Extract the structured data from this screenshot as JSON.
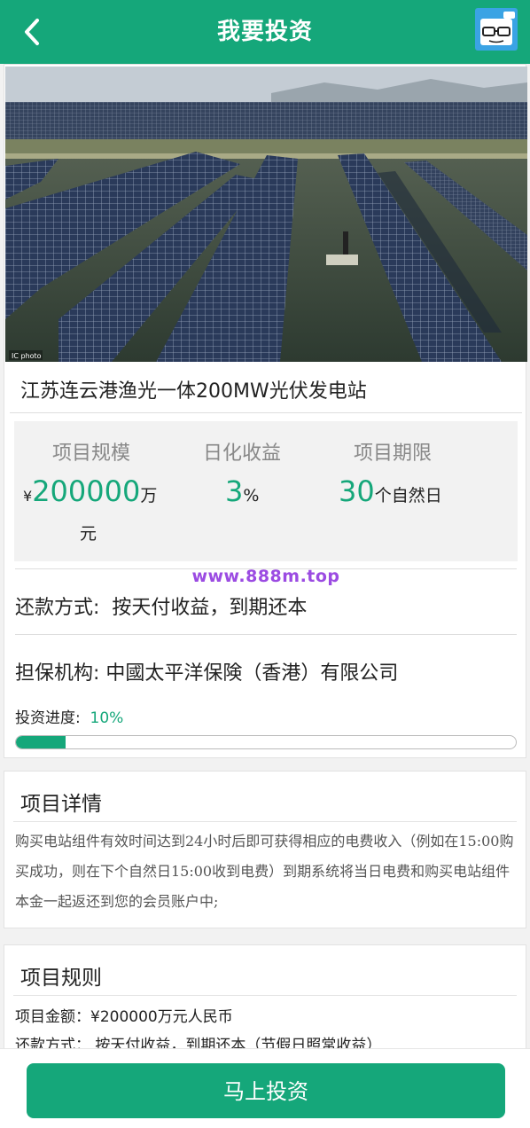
{
  "header": {
    "title": "我要投资",
    "back_icon": "chevron-left-icon",
    "avatar_icon": "cartoon-avatar-icon"
  },
  "project": {
    "name": "江苏连云港渔光一体200MW光伏发电站",
    "photo_credit": "IC photo",
    "stats": {
      "scale_label": "项目规模",
      "scale_currency": "¥",
      "scale_value": "200000",
      "scale_unit_1": "万",
      "scale_unit_2": "元",
      "yield_label": "日化收益",
      "yield_value": "3",
      "yield_unit": "%",
      "term_label": "项目期限",
      "term_value": "30",
      "term_unit": "个自然日"
    },
    "watermark": "www.888m.top",
    "repayment_label": "还款方式:",
    "repayment_value": "按天付收益，到期还本",
    "guarantor_label": "担保机构:",
    "guarantor_value": "中國太平洋保険（香港）有限公司",
    "progress_label": "投资进度:",
    "progress_text": "10%",
    "progress_value": 0.1
  },
  "details": {
    "title": "项目详情",
    "text": "购买电站组件有效时间达到24小时后即可获得相应的电费收入（例如在15:00购买成功，则在下个自然日15:00收到电费）到期系统将当日电费和购买电站组件本金一起返还到您的会员账户中;"
  },
  "rules": {
    "title": "项目规则",
    "amount": "项目金额：¥200000万元人民币",
    "repayment": "还款方式：  按天付收益，到期还本（节假日照常收益）"
  },
  "footer": {
    "invest_button": "马上投资"
  },
  "colors": {
    "brand": "#15a77a",
    "watermark": "#9b4be2"
  }
}
